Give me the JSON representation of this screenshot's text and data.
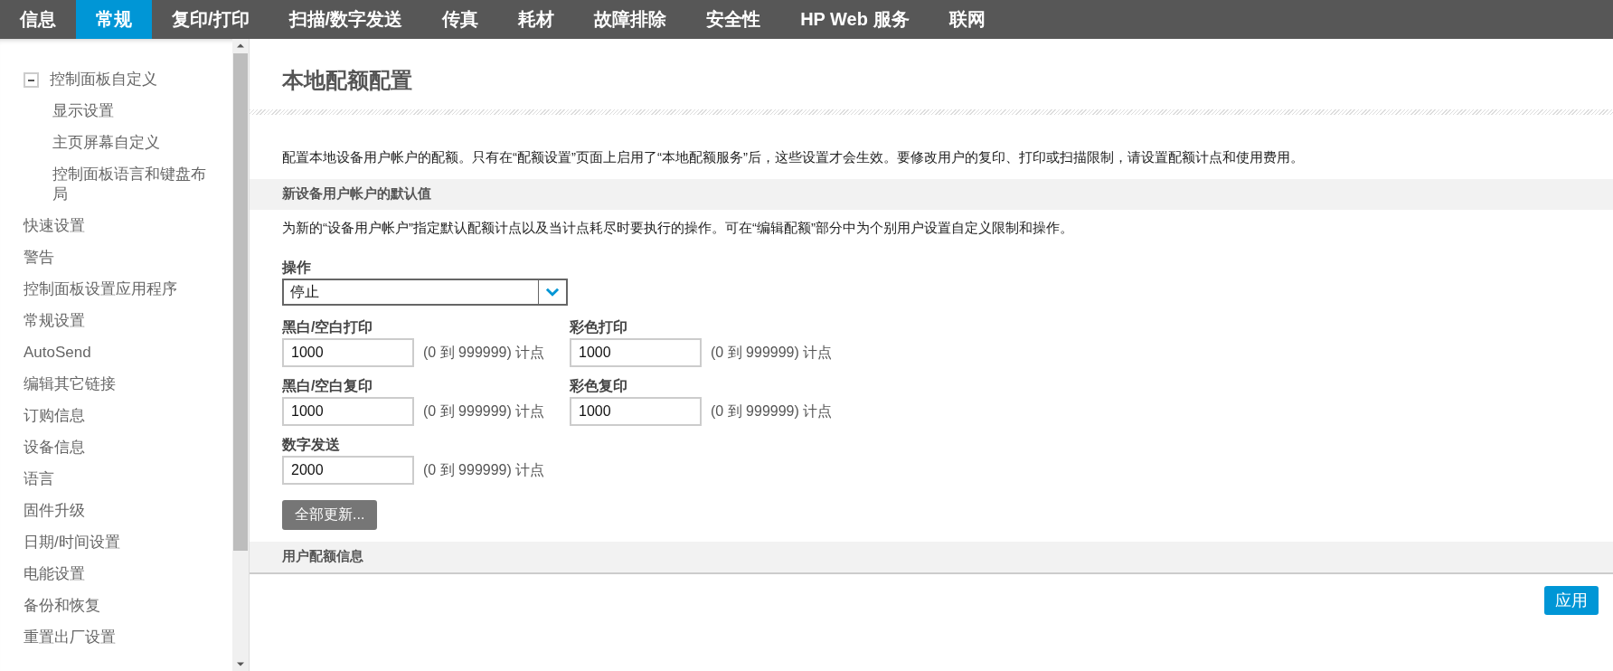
{
  "nav_tabs": [
    {
      "label": "信息",
      "selected": false
    },
    {
      "label": "常规",
      "selected": true
    },
    {
      "label": "复印/打印",
      "selected": false
    },
    {
      "label": "扫描/数字发送",
      "selected": false
    },
    {
      "label": "传真",
      "selected": false
    },
    {
      "label": "耗材",
      "selected": false
    },
    {
      "label": "故障排除",
      "selected": false
    },
    {
      "label": "安全性",
      "selected": false
    },
    {
      "label": "HP Web 服务",
      "selected": false
    },
    {
      "label": "联网",
      "selected": false
    }
  ],
  "sidebar": {
    "items": [
      {
        "label": "控制面板自定义",
        "expanded": true,
        "children": [
          {
            "label": "显示设置"
          },
          {
            "label": "主页屏幕自定义"
          },
          {
            "label": "控制面板语言和键盘布局"
          }
        ]
      },
      {
        "label": "快速设置"
      },
      {
        "label": "警告"
      },
      {
        "label": "控制面板设置应用程序"
      },
      {
        "label": "常规设置"
      },
      {
        "label": "AutoSend"
      },
      {
        "label": "编辑其它链接"
      },
      {
        "label": "订购信息"
      },
      {
        "label": "设备信息"
      },
      {
        "label": "语言"
      },
      {
        "label": "固件升级"
      },
      {
        "label": "日期/时间设置"
      },
      {
        "label": "电能设置"
      },
      {
        "label": "备份和恢复"
      },
      {
        "label": "重置出厂设置"
      }
    ]
  },
  "page": {
    "title": "本地配额配置",
    "description": "配置本地设备用户帐户的配额。只有在“配额设置”页面上启用了“本地配额服务”后，这些设置才会生效。要修改用户的复印、打印或扫描限制，请设置配额计点和使用费用。",
    "section_defaults": {
      "heading": "新设备用户帐户的默认值",
      "description": "为新的“设备用户帐户”指定默认配额计点以及当计点耗尽时要执行的操作。可在“编辑配额”部分中为个别用户设置自定义限制和操作。",
      "operation": {
        "label": "操作",
        "value": "停止"
      },
      "fields": [
        {
          "label": "黑白/空白打印",
          "value": "1000",
          "range": "(0 到 999999) 计点"
        },
        {
          "label": "彩色打印",
          "value": "1000",
          "range": "(0 到 999999) 计点"
        },
        {
          "label": "黑白/空白复印",
          "value": "1000",
          "range": "(0 到 999999) 计点"
        },
        {
          "label": "彩色复印",
          "value": "1000",
          "range": "(0 到 999999) 计点"
        },
        {
          "label": "数字发送",
          "value": "2000",
          "range": "(0 到 999999) 计点"
        }
      ],
      "update_button": "全部更新..."
    },
    "section_users": {
      "heading": "用户配额信息"
    },
    "apply_button": "应用"
  }
}
